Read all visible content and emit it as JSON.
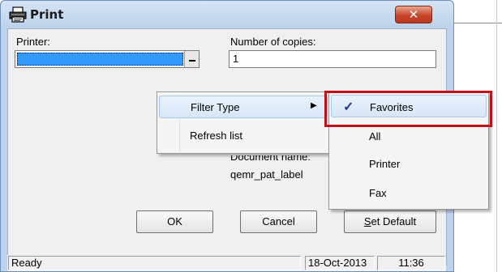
{
  "window": {
    "title": "Print",
    "close_symbol": "✕"
  },
  "form": {
    "printer_label": "Printer:",
    "copies_label": "Number of copies:",
    "copies_value": "1",
    "document_label": "Document name:",
    "document_name": "qemr_pat_label"
  },
  "buttons": {
    "ok": "OK",
    "cancel": "Cancel",
    "set_default_prefix": "S",
    "set_default_rest": "et Default"
  },
  "statusbar": {
    "status": "Ready",
    "date": "18-Oct-2013",
    "time": "11:36"
  },
  "context_menu": {
    "items": [
      {
        "label": "Filter Type",
        "has_submenu": true
      },
      {
        "label": "Refresh list"
      }
    ],
    "submenu_arrow": "▶"
  },
  "submenu": {
    "items": [
      {
        "label": "Favorites",
        "checked": true
      },
      {
        "label": "All"
      },
      {
        "label": "Printer"
      },
      {
        "label": "Fax"
      }
    ],
    "check_symbol": "✓"
  },
  "colors": {
    "highlight_border": "#c0111a",
    "selection": "#3399ff"
  },
  "icons": {
    "title": "printer-icon",
    "close": "close-icon",
    "dropdown": "chevron-down-icon",
    "submenu": "chevron-right-icon",
    "check": "checkmark-icon"
  }
}
